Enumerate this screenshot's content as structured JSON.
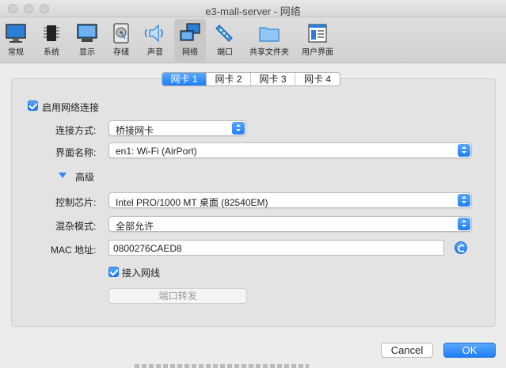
{
  "window": {
    "title": "e3-mall-server - 网络"
  },
  "toolbar": {
    "items": [
      {
        "label": "常规",
        "icon": "monitor-icon"
      },
      {
        "label": "系统",
        "icon": "chip-icon"
      },
      {
        "label": "显示",
        "icon": "display-icon"
      },
      {
        "label": "存储",
        "icon": "disk-icon"
      },
      {
        "label": "声音",
        "icon": "speaker-icon"
      },
      {
        "label": "网络",
        "icon": "network-icon",
        "selected": true
      },
      {
        "label": "端口",
        "icon": "port-icon"
      },
      {
        "label": "共享文件夹",
        "icon": "folder-icon"
      },
      {
        "label": "用户界面",
        "icon": "window-icon"
      }
    ]
  },
  "tabs": [
    {
      "label": "网卡 1",
      "active": true
    },
    {
      "label": "网卡 2"
    },
    {
      "label": "网卡 3"
    },
    {
      "label": "网卡 4"
    }
  ],
  "adapter": {
    "enable_label": "启用网络连接",
    "enable_checked": true,
    "attach_label": "连接方式:",
    "attach_value": "桥接网卡",
    "name_label": "界面名称:",
    "name_value": "en1: Wi-Fi (AirPort)",
    "advanced_label": "高级",
    "adapter_type_label": "控制芯片:",
    "adapter_type_value": "Intel PRO/1000 MT 桌面 (82540EM)",
    "promisc_label": "混杂模式:",
    "promisc_value": "全部允许",
    "mac_label": "MAC 地址:",
    "mac_value": "0800276CAED8",
    "cable_label": "接入网线",
    "cable_checked": true,
    "port_forward_label": "端口转发"
  },
  "buttons": {
    "cancel": "Cancel",
    "ok": "OK"
  },
  "colors": {
    "accent": "#1f7ef7",
    "panel": "#e3e3e3"
  }
}
